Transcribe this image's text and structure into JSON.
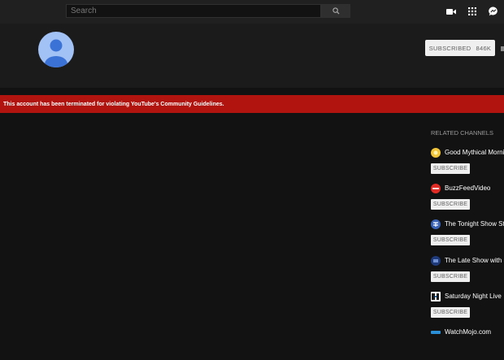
{
  "search": {
    "placeholder": "Search"
  },
  "header": {
    "subscribed_label": "SUBSCRIBED",
    "subscriber_count": "846K"
  },
  "banner": {
    "message": "This account has been terminated for violating YouTube's Community Guidelines."
  },
  "related": {
    "title": "RELATED CHANNELS",
    "channels": [
      {
        "name": "Good Mythical Morni",
        "subscribe_label": "SUBSCRIBE",
        "icon": "good-mythical-morning-icon",
        "color": "#f2c63a"
      },
      {
        "name": "BuzzFeedVideo",
        "subscribe_label": "SUBSCRIBE",
        "icon": "buzzfeed-icon",
        "color": "#e32b25"
      },
      {
        "name": "The Tonight Show Sta",
        "subscribe_label": "SUBSCRIBE",
        "icon": "tonight-show-icon",
        "color": "#3a63b8"
      },
      {
        "name": "The Late Show with S",
        "subscribe_label": "SUBSCRIBE",
        "icon": "late-show-icon",
        "color": "#1f3a7a"
      },
      {
        "name": "Saturday Night Live",
        "subscribe_label": "SUBSCRIBE",
        "icon": "snl-icon",
        "color": "#ffffff"
      },
      {
        "name": "WatchMojo.com",
        "subscribe_label": "",
        "icon": "watchmojo-icon",
        "color": "#2a8fd6"
      }
    ]
  },
  "colors": {
    "banner": "#b1140f",
    "topbar": "#202020",
    "header": "#1b1b1b",
    "background": "#121212",
    "avatar": "#a2c1f4"
  }
}
